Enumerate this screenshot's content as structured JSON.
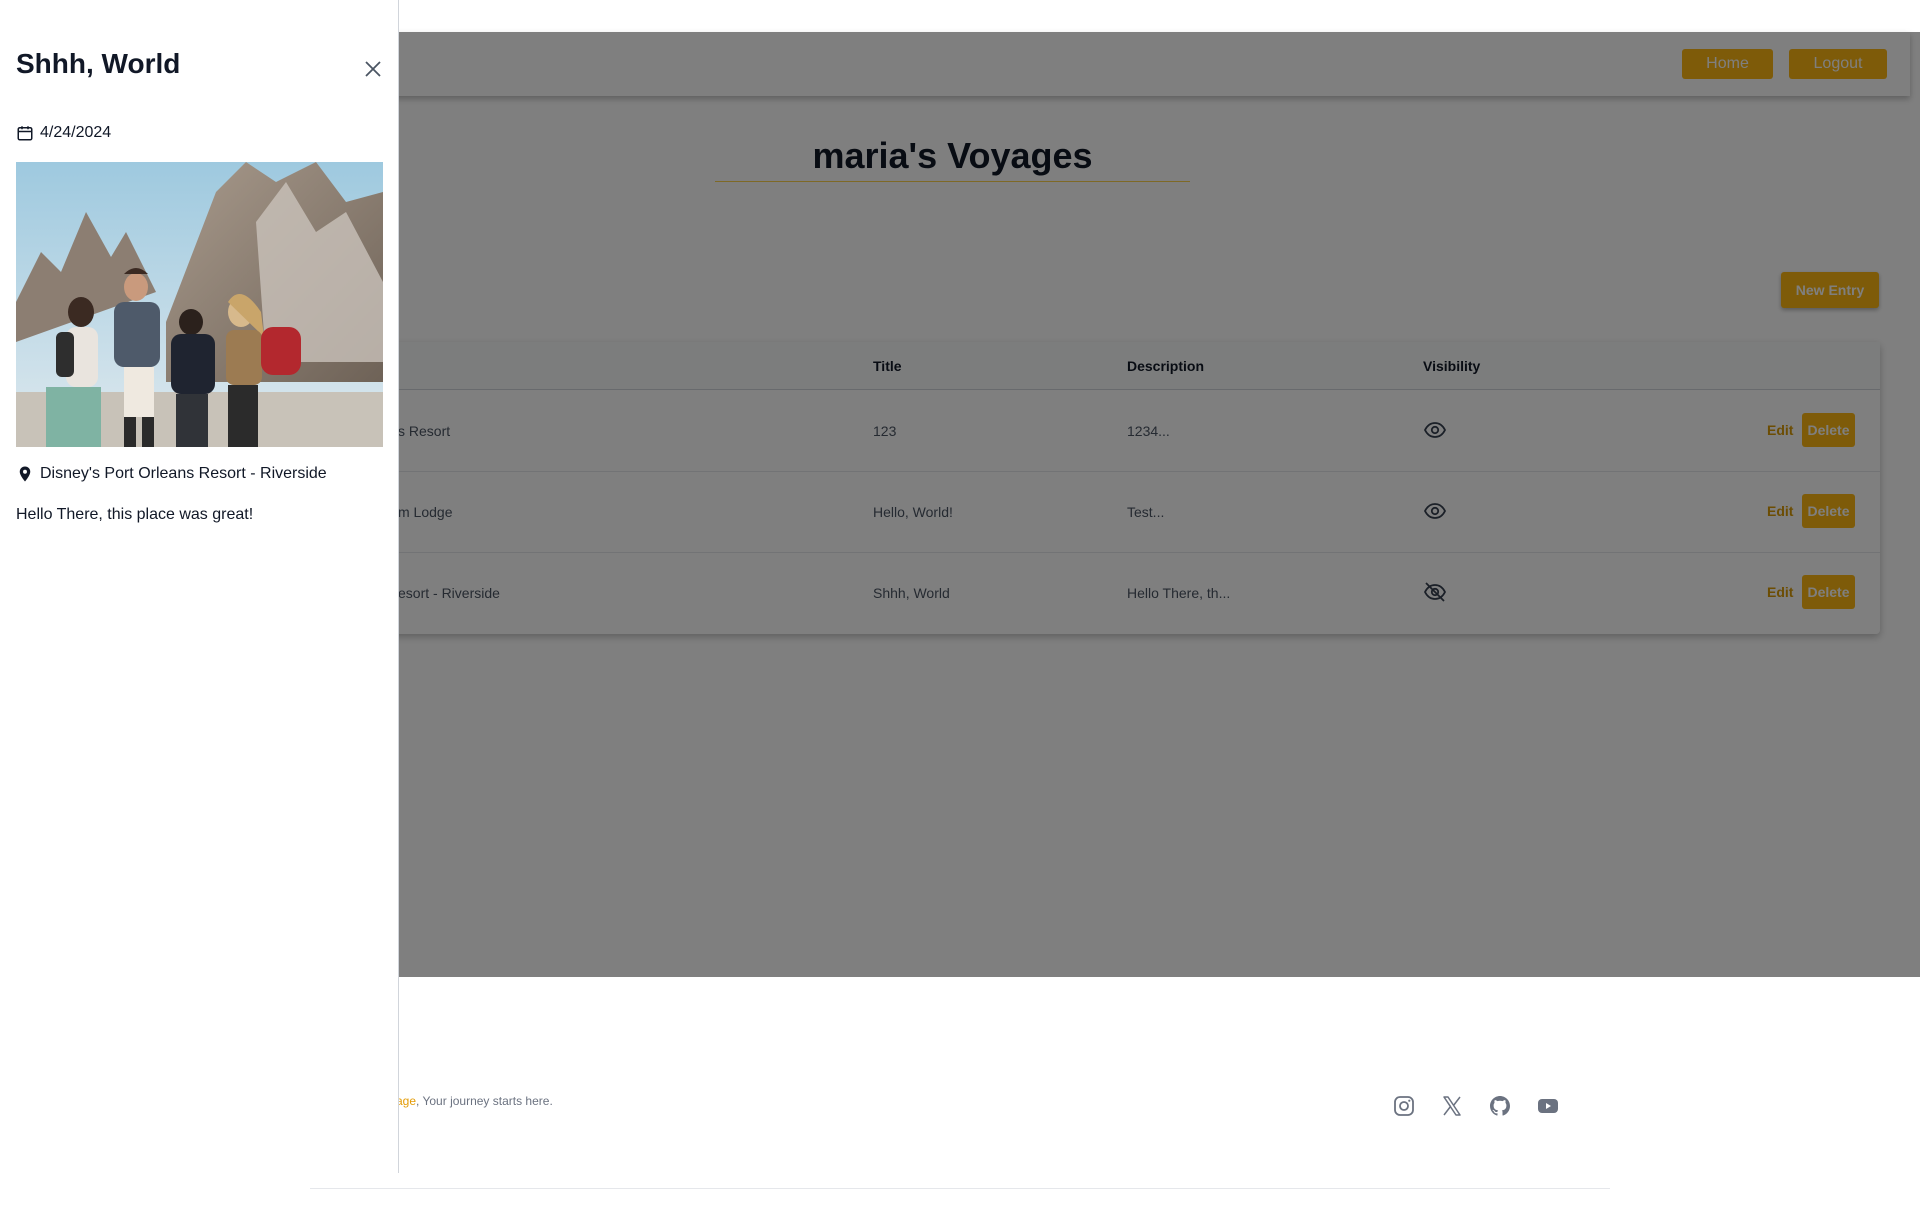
{
  "navbar": {
    "home_label": "Home",
    "logout_label": "Logout"
  },
  "page": {
    "title": "maria's Voyages",
    "new_entry_label": "New Entry"
  },
  "table": {
    "headers": [
      "Title",
      "Description",
      "Visibility"
    ],
    "rows": [
      {
        "location": "s Resort",
        "title": "123",
        "description": "1234...",
        "visibility": "visible",
        "edit_label": "Edit",
        "delete_label": "Delete"
      },
      {
        "location": "m Lodge",
        "title": "Hello, World!",
        "description": "Test...",
        "visibility": "visible",
        "edit_label": "Edit",
        "delete_label": "Delete"
      },
      {
        "location": "esort - Riverside",
        "title": "Shhh, World",
        "description": "Hello There, th...",
        "visibility": "hidden",
        "edit_label": "Edit",
        "delete_label": "Delete"
      }
    ]
  },
  "footer": {
    "brand_fragment": "yage",
    "tagline": ", Your journey starts here.",
    "social_icons": [
      "instagram-icon",
      "x-icon",
      "github-icon",
      "youtube-icon"
    ]
  },
  "drawer": {
    "title": "Shhh, World",
    "date": "4/24/2024",
    "location": "Disney's Port Orleans Resort - Riverside",
    "description": "Hello There, this place was great!"
  },
  "colors": {
    "accent": "#fcb712",
    "overlay": "rgba(0,0,0,0.5)"
  }
}
